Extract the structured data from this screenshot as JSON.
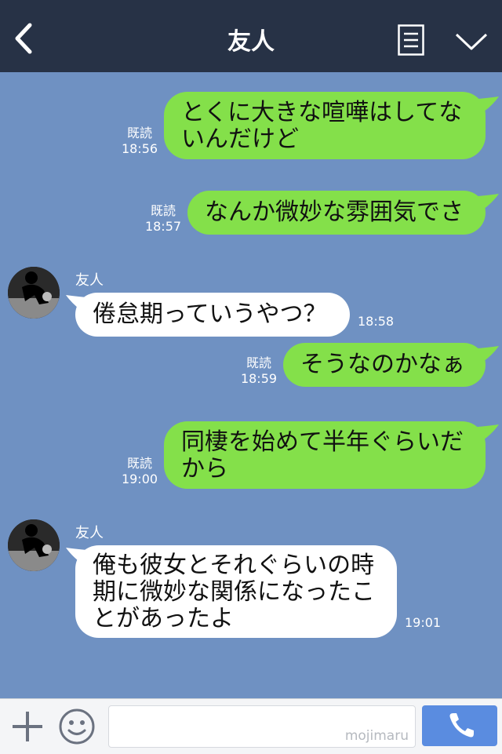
{
  "header": {
    "title": "友人",
    "back_icon": "chevron-left-icon",
    "menu_icon": "note-icon",
    "expand_icon": "chevron-down-icon",
    "background": "#273246"
  },
  "chat": {
    "background": "#6f91c2",
    "outgoing_color": "#84e04a",
    "incoming_color": "#ffffff",
    "messages": [
      {
        "direction": "out",
        "line1": "とくに大きな喧嘩はしてな",
        "line2": "いんだけど",
        "read": "既読",
        "time": "18:56"
      },
      {
        "direction": "out",
        "text": "なんか微妙な雰囲気でさ",
        "read": "既読",
        "time": "18:57"
      },
      {
        "direction": "in",
        "sender": "友人",
        "text": "倦怠期っていうやつ？",
        "time": "18:58"
      },
      {
        "direction": "out",
        "text": "そうなのかなぁ",
        "read": "既読",
        "time": "18:59"
      },
      {
        "direction": "out",
        "line1": "同棲を始めて半年ぐらいだ",
        "line2": "から",
        "read": "既読",
        "time": "19:00"
      },
      {
        "direction": "in",
        "sender": "友人",
        "line1": "俺も彼女とそれぐらいの時",
        "line2": "期に微妙な関係になったこ",
        "line3": "とがあったよ",
        "time": "19:01"
      }
    ]
  },
  "input_bar": {
    "plus_icon": "plus-icon",
    "sticker_icon": "smiley-icon",
    "watermark": "mojimaru",
    "call_icon": "phone-icon",
    "call_color": "#5a8ce0"
  }
}
